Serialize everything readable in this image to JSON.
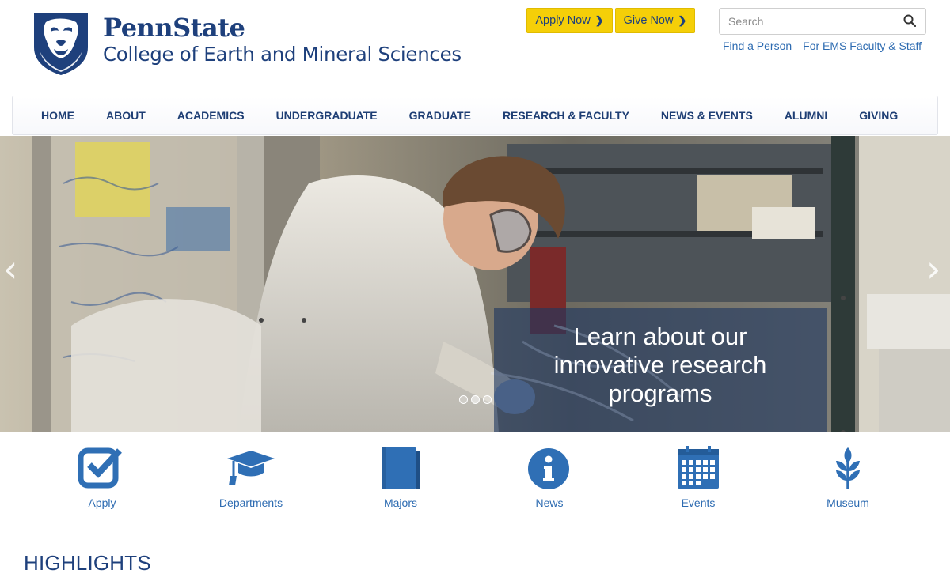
{
  "brand": {
    "name": "PennState",
    "college": "College of Earth and Mineral Sciences"
  },
  "header": {
    "apply_now": "Apply Now",
    "give_now": "Give Now",
    "search_placeholder": "Search",
    "util_links": [
      "Find a Person",
      "For EMS Faculty & Staff"
    ]
  },
  "nav": {
    "items": [
      "HOME",
      "ABOUT",
      "ACADEMICS",
      "UNDERGRADUATE",
      "GRADUATE",
      "RESEARCH & FACULTY",
      "NEWS & EVENTS",
      "ALUMNI",
      "GIVING"
    ]
  },
  "hero": {
    "caption_line1": "Learn about our",
    "caption_line2": "innovative research",
    "caption_line3": "programs",
    "slide_count": 3,
    "active_slide": 2,
    "prev_icon": "chevron-left-icon",
    "next_icon": "chevron-right-icon"
  },
  "quick_links": [
    {
      "label": "Apply",
      "icon": "checkbox-icon"
    },
    {
      "label": "Departments",
      "icon": "graduation-cap-icon"
    },
    {
      "label": "Majors",
      "icon": "book-icon"
    },
    {
      "label": "News",
      "icon": "info-circle-icon"
    },
    {
      "label": "Events",
      "icon": "calendar-icon"
    },
    {
      "label": "Museum",
      "icon": "wheat-icon"
    }
  ],
  "section": {
    "highlights": "HIGHLIGHTS"
  },
  "colors": {
    "brand_navy": "#1e407c",
    "link_blue": "#2d6bb1",
    "cta_yellow": "#f5cf08",
    "icon_blue": "#2f6fb5"
  }
}
